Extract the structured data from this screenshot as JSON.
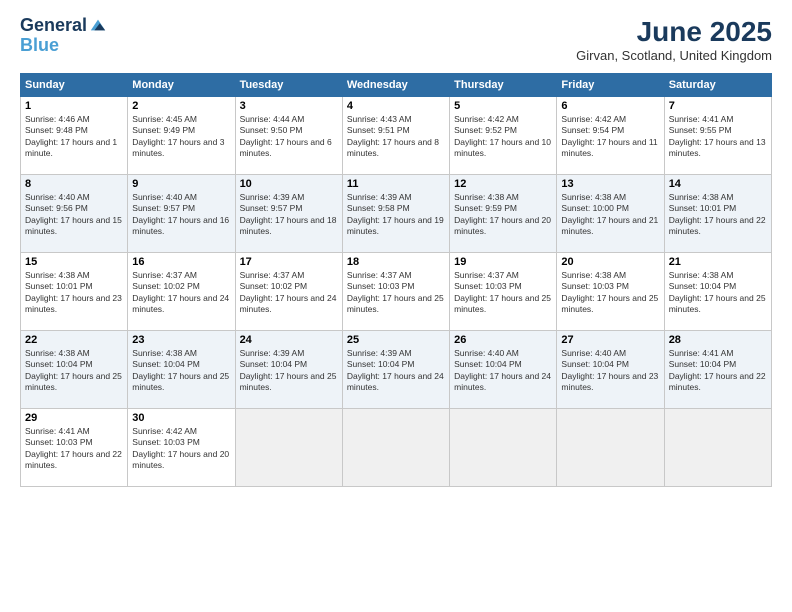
{
  "logo": {
    "line1": "General",
    "line2": "Blue"
  },
  "title": "June 2025",
  "location": "Girvan, Scotland, United Kingdom",
  "weekdays": [
    "Sunday",
    "Monday",
    "Tuesday",
    "Wednesday",
    "Thursday",
    "Friday",
    "Saturday"
  ],
  "weeks": [
    [
      {
        "day": "1",
        "sunrise": "Sunrise: 4:46 AM",
        "sunset": "Sunset: 9:48 PM",
        "daylight": "Daylight: 17 hours and 1 minute."
      },
      {
        "day": "2",
        "sunrise": "Sunrise: 4:45 AM",
        "sunset": "Sunset: 9:49 PM",
        "daylight": "Daylight: 17 hours and 3 minutes."
      },
      {
        "day": "3",
        "sunrise": "Sunrise: 4:44 AM",
        "sunset": "Sunset: 9:50 PM",
        "daylight": "Daylight: 17 hours and 6 minutes."
      },
      {
        "day": "4",
        "sunrise": "Sunrise: 4:43 AM",
        "sunset": "Sunset: 9:51 PM",
        "daylight": "Daylight: 17 hours and 8 minutes."
      },
      {
        "day": "5",
        "sunrise": "Sunrise: 4:42 AM",
        "sunset": "Sunset: 9:52 PM",
        "daylight": "Daylight: 17 hours and 10 minutes."
      },
      {
        "day": "6",
        "sunrise": "Sunrise: 4:42 AM",
        "sunset": "Sunset: 9:54 PM",
        "daylight": "Daylight: 17 hours and 11 minutes."
      },
      {
        "day": "7",
        "sunrise": "Sunrise: 4:41 AM",
        "sunset": "Sunset: 9:55 PM",
        "daylight": "Daylight: 17 hours and 13 minutes."
      }
    ],
    [
      {
        "day": "8",
        "sunrise": "Sunrise: 4:40 AM",
        "sunset": "Sunset: 9:56 PM",
        "daylight": "Daylight: 17 hours and 15 minutes."
      },
      {
        "day": "9",
        "sunrise": "Sunrise: 4:40 AM",
        "sunset": "Sunset: 9:57 PM",
        "daylight": "Daylight: 17 hours and 16 minutes."
      },
      {
        "day": "10",
        "sunrise": "Sunrise: 4:39 AM",
        "sunset": "Sunset: 9:57 PM",
        "daylight": "Daylight: 17 hours and 18 minutes."
      },
      {
        "day": "11",
        "sunrise": "Sunrise: 4:39 AM",
        "sunset": "Sunset: 9:58 PM",
        "daylight": "Daylight: 17 hours and 19 minutes."
      },
      {
        "day": "12",
        "sunrise": "Sunrise: 4:38 AM",
        "sunset": "Sunset: 9:59 PM",
        "daylight": "Daylight: 17 hours and 20 minutes."
      },
      {
        "day": "13",
        "sunrise": "Sunrise: 4:38 AM",
        "sunset": "Sunset: 10:00 PM",
        "daylight": "Daylight: 17 hours and 21 minutes."
      },
      {
        "day": "14",
        "sunrise": "Sunrise: 4:38 AM",
        "sunset": "Sunset: 10:01 PM",
        "daylight": "Daylight: 17 hours and 22 minutes."
      }
    ],
    [
      {
        "day": "15",
        "sunrise": "Sunrise: 4:38 AM",
        "sunset": "Sunset: 10:01 PM",
        "daylight": "Daylight: 17 hours and 23 minutes."
      },
      {
        "day": "16",
        "sunrise": "Sunrise: 4:37 AM",
        "sunset": "Sunset: 10:02 PM",
        "daylight": "Daylight: 17 hours and 24 minutes."
      },
      {
        "day": "17",
        "sunrise": "Sunrise: 4:37 AM",
        "sunset": "Sunset: 10:02 PM",
        "daylight": "Daylight: 17 hours and 24 minutes."
      },
      {
        "day": "18",
        "sunrise": "Sunrise: 4:37 AM",
        "sunset": "Sunset: 10:03 PM",
        "daylight": "Daylight: 17 hours and 25 minutes."
      },
      {
        "day": "19",
        "sunrise": "Sunrise: 4:37 AM",
        "sunset": "Sunset: 10:03 PM",
        "daylight": "Daylight: 17 hours and 25 minutes."
      },
      {
        "day": "20",
        "sunrise": "Sunrise: 4:38 AM",
        "sunset": "Sunset: 10:03 PM",
        "daylight": "Daylight: 17 hours and 25 minutes."
      },
      {
        "day": "21",
        "sunrise": "Sunrise: 4:38 AM",
        "sunset": "Sunset: 10:04 PM",
        "daylight": "Daylight: 17 hours and 25 minutes."
      }
    ],
    [
      {
        "day": "22",
        "sunrise": "Sunrise: 4:38 AM",
        "sunset": "Sunset: 10:04 PM",
        "daylight": "Daylight: 17 hours and 25 minutes."
      },
      {
        "day": "23",
        "sunrise": "Sunrise: 4:38 AM",
        "sunset": "Sunset: 10:04 PM",
        "daylight": "Daylight: 17 hours and 25 minutes."
      },
      {
        "day": "24",
        "sunrise": "Sunrise: 4:39 AM",
        "sunset": "Sunset: 10:04 PM",
        "daylight": "Daylight: 17 hours and 25 minutes."
      },
      {
        "day": "25",
        "sunrise": "Sunrise: 4:39 AM",
        "sunset": "Sunset: 10:04 PM",
        "daylight": "Daylight: 17 hours and 24 minutes."
      },
      {
        "day": "26",
        "sunrise": "Sunrise: 4:40 AM",
        "sunset": "Sunset: 10:04 PM",
        "daylight": "Daylight: 17 hours and 24 minutes."
      },
      {
        "day": "27",
        "sunrise": "Sunrise: 4:40 AM",
        "sunset": "Sunset: 10:04 PM",
        "daylight": "Daylight: 17 hours and 23 minutes."
      },
      {
        "day": "28",
        "sunrise": "Sunrise: 4:41 AM",
        "sunset": "Sunset: 10:04 PM",
        "daylight": "Daylight: 17 hours and 22 minutes."
      }
    ],
    [
      {
        "day": "29",
        "sunrise": "Sunrise: 4:41 AM",
        "sunset": "Sunset: 10:03 PM",
        "daylight": "Daylight: 17 hours and 22 minutes."
      },
      {
        "day": "30",
        "sunrise": "Sunrise: 4:42 AM",
        "sunset": "Sunset: 10:03 PM",
        "daylight": "Daylight: 17 hours and 20 minutes."
      },
      null,
      null,
      null,
      null,
      null
    ]
  ]
}
